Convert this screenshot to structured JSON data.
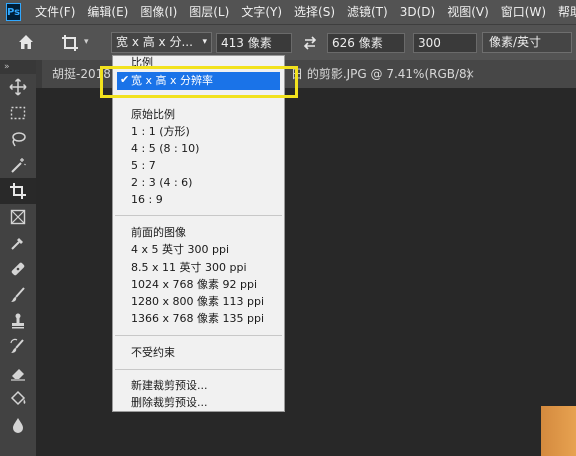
{
  "app": {
    "logo": "Ps"
  },
  "menubar": {
    "items": [
      "文件(F)",
      "编辑(E)",
      "图像(I)",
      "图层(L)",
      "文字(Y)",
      "选择(S)",
      "滤镜(T)",
      "3D(D)",
      "视图(V)",
      "窗口(W)",
      "帮助(H)"
    ]
  },
  "options": {
    "preset_value": "宽 x 高 x 分...",
    "width_value": "413 像素",
    "height_value": "626 像素",
    "resolution_value": "300",
    "unit_value": "像素/英寸"
  },
  "toolbar": {
    "collapse_glyph": "»"
  },
  "document": {
    "tab_title": "胡挺-2018... 的剪影.JPG @ 7.41%(RGB/8)",
    "tab_title_left": "胡挺-2018",
    "tab_title_right": "日 的剪影.JPG @ 7.41%(RGB/8)",
    "close_glyph": "×"
  },
  "dropdown": {
    "header": "比例",
    "selected": "宽 x 高 x 分辨率",
    "group_ratios": [
      "原始比例",
      "1 : 1 (方形)",
      "4 : 5 (8 : 10)",
      "5 : 7",
      "2 : 3 (4 : 6)",
      "16 : 9"
    ],
    "group_images": [
      "前面的图像",
      "4 x 5 英寸 300 ppi",
      "8.5 x 11 英寸 300 ppi",
      "1024 x 768 像素 92 ppi",
      "1280 x 800 像素 113 ppi",
      "1366 x 768 像素 135 ppi"
    ],
    "unconstrained": "不受约束",
    "new_preset": "新建裁剪预设...",
    "delete_preset": "删除裁剪预设..."
  },
  "colors": {
    "highlight": "#f2e21d",
    "selection": "#1a73e8",
    "image_edge": "#e09a4a"
  }
}
